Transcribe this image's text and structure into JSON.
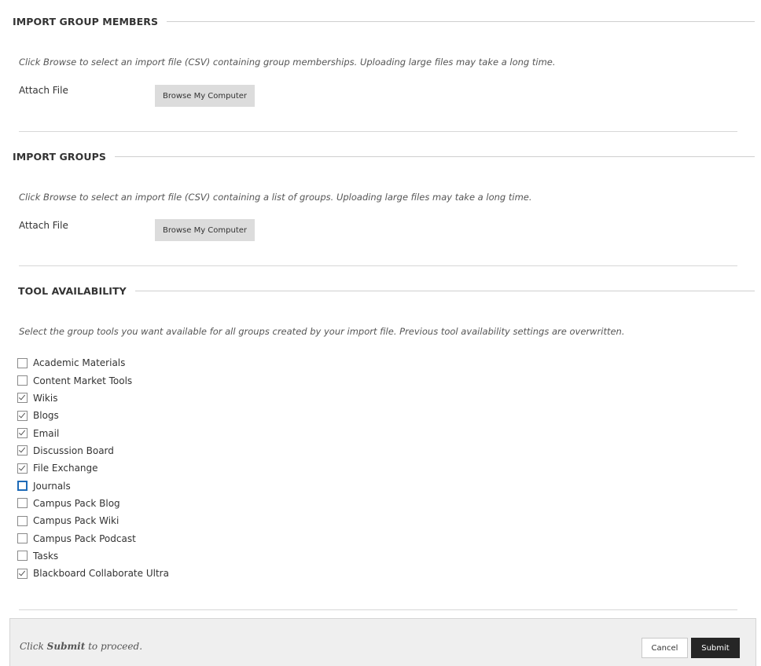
{
  "import_members": {
    "heading": "IMPORT GROUP MEMBERS",
    "instructions": "Click Browse to select an import file (CSV) containing group memberships. Uploading large files may take a long time.",
    "attach_label": "Attach File",
    "browse_label": "Browse My Computer"
  },
  "import_groups": {
    "heading": "IMPORT GROUPS",
    "instructions": "Click Browse to select an import file (CSV) containing a list of groups. Uploading large files may take a long time.",
    "attach_label": "Attach File",
    "browse_label": "Browse My Computer"
  },
  "tool_availability": {
    "heading": "TOOL AVAILABILITY",
    "instructions": "Select the group tools you want available for all groups created by your import file. Previous tool availability settings are overwritten.",
    "tools": [
      {
        "label": "Academic Materials",
        "checked": false
      },
      {
        "label": "Content Market Tools",
        "checked": false
      },
      {
        "label": "Wikis",
        "checked": true
      },
      {
        "label": "Blogs",
        "checked": true
      },
      {
        "label": "Email",
        "checked": true
      },
      {
        "label": "Discussion Board",
        "checked": true
      },
      {
        "label": "File Exchange",
        "checked": true
      },
      {
        "label": "Journals",
        "checked": false,
        "focused": true
      },
      {
        "label": "Campus Pack Blog",
        "checked": false
      },
      {
        "label": "Campus Pack Wiki",
        "checked": false
      },
      {
        "label": "Campus Pack Podcast",
        "checked": false
      },
      {
        "label": "Tasks",
        "checked": false
      },
      {
        "label": "Blackboard Collaborate Ultra",
        "checked": true
      }
    ]
  },
  "footer": {
    "text_before": "Click ",
    "text_bold": "Submit",
    "text_after": " to proceed.",
    "cancel_label": "Cancel",
    "submit_label": "Submit"
  },
  "colors": {
    "focus_ring": "#1e6bb8",
    "submit_bg": "#262626",
    "browse_bg": "#dcdcdc",
    "footer_bg": "#efefef"
  }
}
